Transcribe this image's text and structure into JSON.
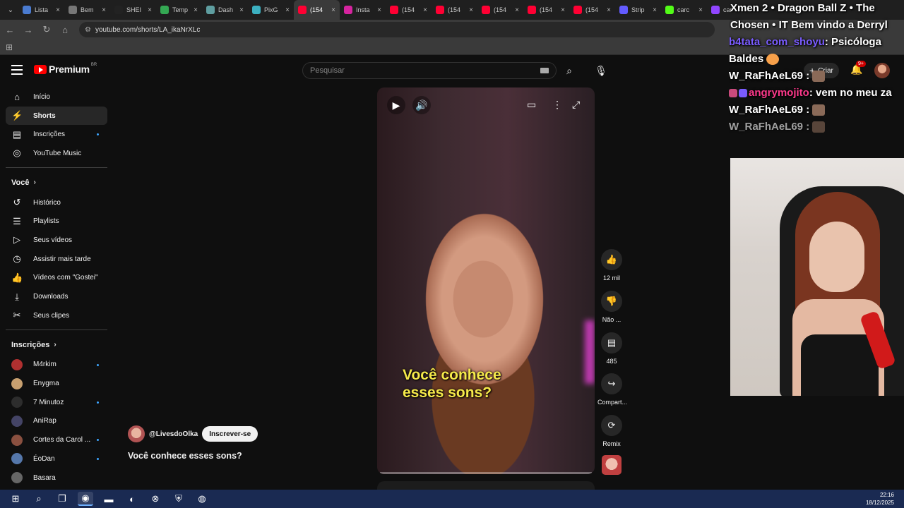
{
  "browser": {
    "tabs": [
      {
        "label": "Lista",
        "color": "#4a7bd0"
      },
      {
        "label": "Bem",
        "color": "#777777"
      },
      {
        "label": "SHEI",
        "color": "#222222"
      },
      {
        "label": "Temp",
        "color": "#34a853"
      },
      {
        "label": "Dash",
        "color": "#5f9ea0"
      },
      {
        "label": "PixG",
        "color": "#3cb0c0"
      },
      {
        "label": "(154",
        "color": "#ff0033"
      },
      {
        "label": "Insta",
        "color": "#d6249f"
      },
      {
        "label": "(154",
        "color": "#ff0033"
      },
      {
        "label": "(154",
        "color": "#ff0033"
      },
      {
        "label": "(154",
        "color": "#ff0033"
      },
      {
        "label": "(154",
        "color": "#ff0033"
      },
      {
        "label": "(154",
        "color": "#ff0033"
      },
      {
        "label": "Strip",
        "color": "#635bff"
      },
      {
        "label": "carc",
        "color": "#53fc18"
      },
      {
        "label": "car",
        "color": "#9146ff"
      }
    ],
    "active_tab_index": 6,
    "url": "youtube.com/shorts/LA_ikaNrXLc"
  },
  "header": {
    "brand": "Premium",
    "country": "BR",
    "search_placeholder": "Pesquisar",
    "create_label": "Criar",
    "notif_count": "9+"
  },
  "sidebar": {
    "main": [
      {
        "label": "Início",
        "icon": "home-icon",
        "glyph": "⌂"
      },
      {
        "label": "Shorts",
        "icon": "shorts-icon",
        "glyph": "⚡",
        "selected": true
      },
      {
        "label": "Inscrições",
        "icon": "subscriptions-icon",
        "glyph": "▤",
        "dot": true
      },
      {
        "label": "YouTube Music",
        "icon": "music-icon",
        "glyph": "◎"
      }
    ],
    "you_title": "Você",
    "you": [
      {
        "label": "Histórico",
        "icon": "history-icon",
        "glyph": "↺"
      },
      {
        "label": "Playlists",
        "icon": "playlists-icon",
        "glyph": "☰"
      },
      {
        "label": "Seus vídeos",
        "icon": "your-videos-icon",
        "glyph": "▷"
      },
      {
        "label": "Assistir mais tarde",
        "icon": "watch-later-icon",
        "glyph": "◷"
      },
      {
        "label": "Vídeos com \"Gostei\"",
        "icon": "liked-icon",
        "glyph": "👍"
      },
      {
        "label": "Downloads",
        "icon": "download-icon",
        "glyph": "⤓"
      },
      {
        "label": "Seus clipes",
        "icon": "clips-icon",
        "glyph": "✂"
      }
    ],
    "subs_title": "Inscrições",
    "subs": [
      {
        "label": "M4rkim",
        "color": "#b03030",
        "dot": true
      },
      {
        "label": "Enygma",
        "color": "#c8a070",
        "dot": false
      },
      {
        "label": "7 Minutoz",
        "color": "#2d2d2d",
        "dot": true
      },
      {
        "label": "AniRap",
        "color": "#444466",
        "dot": false
      },
      {
        "label": "Cortes da Carol ...",
        "color": "#8a5040",
        "dot": true
      },
      {
        "label": "ÉoDan",
        "color": "#5577aa",
        "dot": true
      },
      {
        "label": "Basara",
        "color": "#666666",
        "dot": false
      }
    ]
  },
  "video": {
    "caption_line1": "Você conhece",
    "caption_line2": "esses sons?",
    "channel": "@LivesdoOlka",
    "subscribe_label": "Inscrever-se",
    "title": "Você conhece esses sons?"
  },
  "actions": {
    "like_count": "12 mil",
    "dislike_label": "Não ...",
    "comments_count": "485",
    "share_label": "Compart...",
    "remix_label": "Remix"
  },
  "overlay_chat": {
    "title_line1": "Xmen 2 • Dragon Ball Z • The",
    "title_line2": "Chosen • IT Bem vindo a Derryl",
    "messages": [
      {
        "user": "b4tata_com_shoyu",
        "text": ": Psicóloga",
        "user_color": "#7a5cff"
      },
      {
        "user": "",
        "text": "Baldes",
        "user_color": "#ffffff"
      },
      {
        "user": "W_RaFhAeL69",
        "text": " :",
        "user_color": "#ffffff"
      },
      {
        "user": "angrymojito",
        "text": ": vem no meu za",
        "user_color": "#ff3a8c"
      },
      {
        "user": "W_RaFhAeL69",
        "text": " :",
        "user_color": "#ffffff"
      },
      {
        "user": "W_RaFhAeL69",
        "text": " :",
        "user_color": "#ffffff"
      }
    ]
  },
  "taskbar": {
    "time": "22:16",
    "date": "18/12/2025"
  }
}
